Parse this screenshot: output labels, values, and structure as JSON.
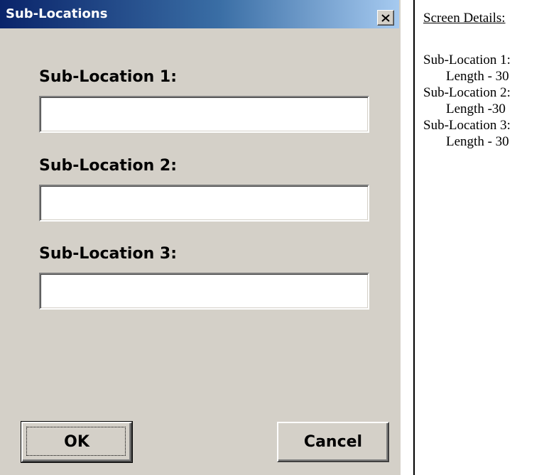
{
  "window": {
    "title": "Sub-Locations",
    "close_glyph": "✕"
  },
  "fields": [
    {
      "label": "Sub-Location 1:",
      "value": "",
      "placeholder": ""
    },
    {
      "label": "Sub-Location 2:",
      "value": "",
      "placeholder": ""
    },
    {
      "label": "Sub-Location 3:",
      "value": "",
      "placeholder": ""
    }
  ],
  "buttons": {
    "ok_label": "OK",
    "cancel_label": "Cancel"
  },
  "details": {
    "heading": "Screen Details:",
    "items": [
      {
        "name": "Sub-Location 1:",
        "length": "Length - 30"
      },
      {
        "name": "Sub-Location 2:",
        "length": "Length -30"
      },
      {
        "name": "Sub-Location 3:",
        "length": "Length - 30"
      }
    ]
  },
  "colors": {
    "dialog_face": "#d4d0c8",
    "title_start": "#0a246a",
    "title_end": "#a6caf0",
    "title_text": "#ffffff"
  },
  "icons": {
    "close": "close-icon"
  }
}
